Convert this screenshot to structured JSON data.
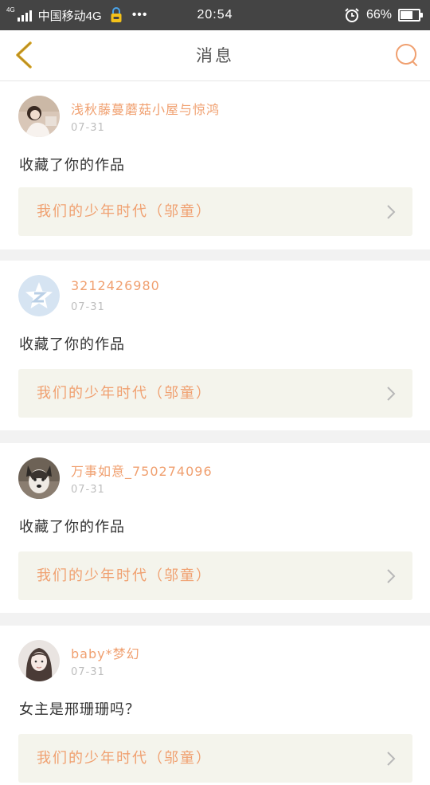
{
  "status_bar": {
    "network": "4G",
    "carrier": "中国移动4G",
    "dots": "•••",
    "time": "20:54",
    "battery": "66%",
    "battery_level": 0.66,
    "icons": [
      "signal-icon",
      "app-notification-icon",
      "alarm-icon",
      "battery-icon"
    ]
  },
  "header": {
    "title": "消息",
    "back_icon": "chevron-left-icon",
    "search_icon": "search-icon"
  },
  "colors": {
    "accent": "#f0a070",
    "back_arrow": "#d9a520",
    "link_bg": "#f4f4ec"
  },
  "messages": [
    {
      "user": "浅秋藤蔓蘑菇小屋与惊鸿",
      "date": "07-31",
      "text": "收藏了你的作品",
      "work": "我们的少年时代（邬童）",
      "avatar": "photo-avatar"
    },
    {
      "user": "3212426980",
      "date": "07-31",
      "text": "收藏了你的作品",
      "work": "我们的少年时代（邬童）",
      "avatar": "qzone-default-avatar"
    },
    {
      "user": "万事如意_750274096",
      "date": "07-31",
      "text": "收藏了你的作品",
      "work": "我们的少年时代（邬童）",
      "avatar": "dog-photo-avatar"
    },
    {
      "user": "baby*梦幻",
      "date": "07-31",
      "text": "女主是邢珊珊吗？",
      "work": "我们的少年时代（邬童）",
      "avatar": "girl-photo-avatar"
    }
  ]
}
